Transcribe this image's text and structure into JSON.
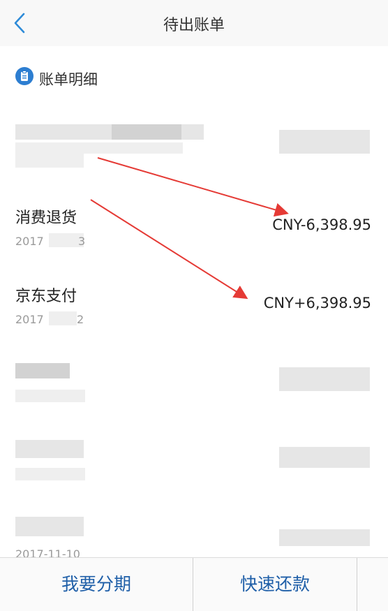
{
  "header": {
    "title": "待出账单"
  },
  "section": {
    "title": "账单明细"
  },
  "transactions": [
    {
      "title": "",
      "date": "",
      "amount": ""
    },
    {
      "title": "消费退货",
      "date": "2017",
      "date_tail": "3",
      "amount": "CNY-6,398.95"
    },
    {
      "title": "京东支付",
      "date": "2017",
      "date_tail": "2",
      "amount": "CNY+6,398.95"
    },
    {
      "title": "",
      "date": "",
      "amount": ""
    },
    {
      "title": "",
      "date": "",
      "amount": ""
    },
    {
      "title": "",
      "date": "2017-11-10",
      "amount": ""
    }
  ],
  "actions": {
    "installment": "我要分期",
    "quick_repay": "快速还款"
  },
  "colors": {
    "accent": "#1f5fa8",
    "annotation": "#e53a35"
  },
  "icons": {
    "back": "chevron-left-icon",
    "section": "clipboard-icon"
  }
}
